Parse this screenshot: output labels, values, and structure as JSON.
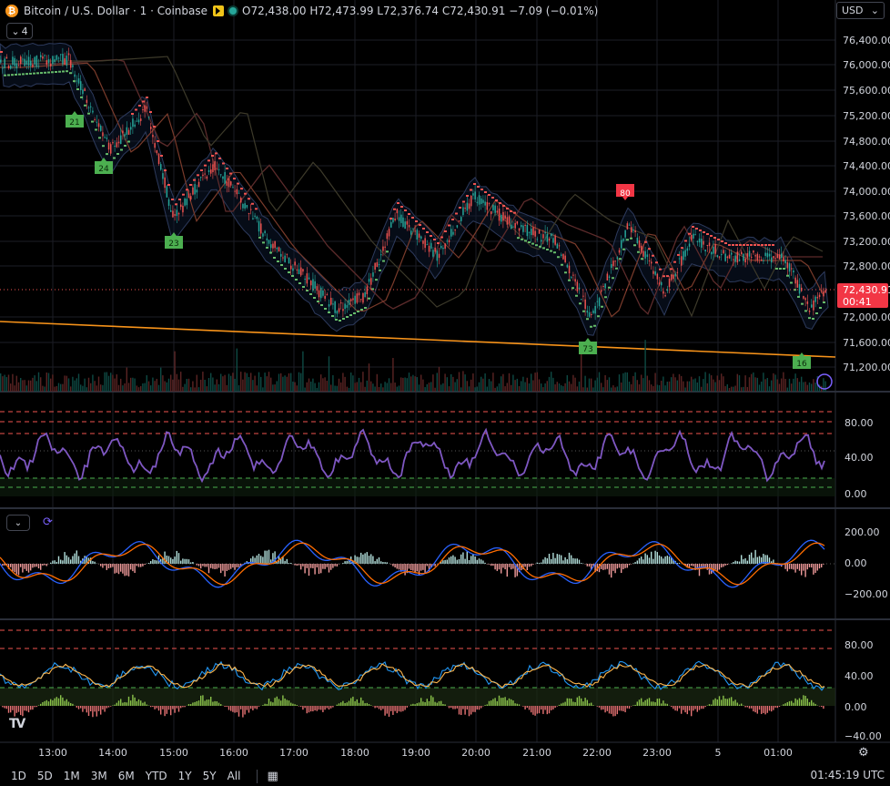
{
  "header": {
    "symbol": "Bitcoin / U.S. Dollar · 1 · Coinbase",
    "ohlc": [
      {
        "k": "O",
        "v": "72,438.00"
      },
      {
        "k": "H",
        "v": "72,473.99"
      },
      {
        "k": "L",
        "v": "72,376.74"
      },
      {
        "k": "C",
        "v": "72,430.91"
      }
    ],
    "change": "−7.09 (−0.01%)",
    "indicator_count": "4",
    "currency": "USD"
  },
  "price_axis": {
    "ticks": [
      "76,400.00",
      "76,000.00",
      "75,600.00",
      "75,200.00",
      "74,800.00",
      "74,400.00",
      "74,000.00",
      "73,600.00",
      "73,200.00",
      "72,800.00",
      "72,000.00",
      "71,600.00",
      "71,200.00"
    ],
    "last_price": "72,430.91",
    "countdown": "00:41"
  },
  "rsi_axis": [
    "80.00",
    "40.00",
    "0.00"
  ],
  "macd_axis": [
    "200.00",
    "0.00",
    "−200.00"
  ],
  "stoch_axis": [
    "80.00",
    "40.00",
    "0.00",
    "−40.00"
  ],
  "time_axis": [
    "13:00",
    "14:00",
    "15:00",
    "16:00",
    "17:00",
    "18:00",
    "19:00",
    "20:00",
    "21:00",
    "22:00",
    "23:00",
    "5",
    "01:00"
  ],
  "markers": [
    {
      "label": "21",
      "kind": "low"
    },
    {
      "label": "24",
      "kind": "low"
    },
    {
      "label": "23",
      "kind": "low"
    },
    {
      "label": "80",
      "kind": "high"
    },
    {
      "label": "73",
      "kind": "low"
    },
    {
      "label": "16",
      "kind": "low"
    }
  ],
  "bottombar": {
    "ranges": [
      "1D",
      "5D",
      "1M",
      "3M",
      "6M",
      "YTD",
      "1Y",
      "5Y",
      "All"
    ],
    "clock": "01:45:19 UTC"
  },
  "colors": {
    "up": "#26a69a",
    "down": "#ef5350",
    "rsi": "#7e57c2",
    "trend": "#f7931a",
    "macd": "#2962ff",
    "signal": "#ff6d00",
    "marker_low": "#4caf50",
    "marker_high": "#f23645"
  }
}
